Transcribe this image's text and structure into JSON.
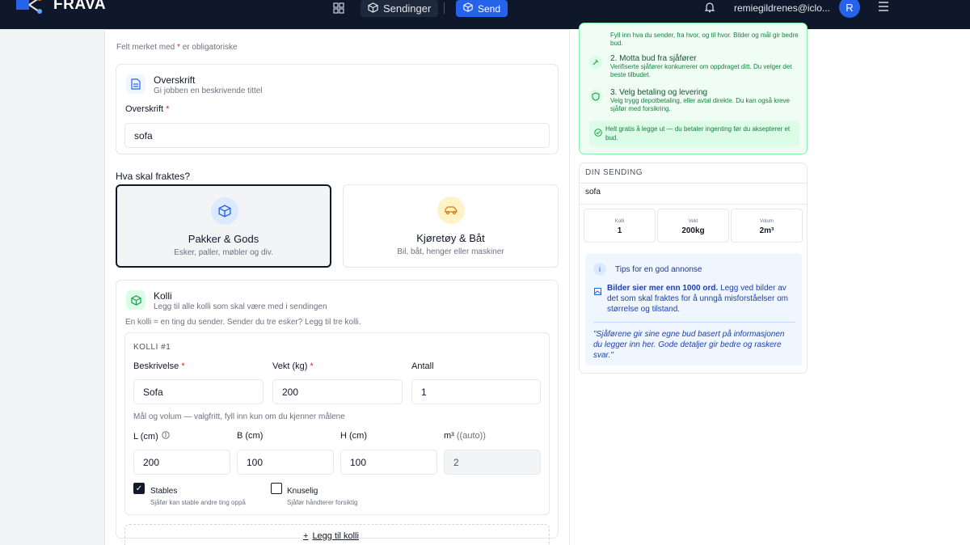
{
  "topbar": {
    "brand": "FRAVA",
    "nav_list_label": "Sendinger",
    "nav_send_label": "Send",
    "user_email": "remiegildrenes@iclo...",
    "avatar_initial": "R"
  },
  "form": {
    "required_note": "Felt merket med",
    "required_note_tail": "er obligatoriske",
    "heading_section": {
      "title": "Overskrift",
      "subtitle": "Gi jobben en beskrivende tittel",
      "field_label": "Overskrift",
      "value": "sofa"
    },
    "cargo_question": "Hva skal fraktes?",
    "cargo_options": [
      {
        "title": "Pakker & Gods",
        "subtitle": "Esker, paller, møbler og div.",
        "selected": true
      },
      {
        "title": "Kjøretøy & Båt",
        "subtitle": "Bil, båt, henger eller maskiner",
        "selected": false
      }
    ],
    "kolli_section": {
      "title": "Kolli",
      "subtitle": "Legg til alle kolli som skal være med i sendingen",
      "hint": "En kolli = en ting du sender. Sender du tre esker? Legg til tre kolli.",
      "item_title": "KOLLI #1",
      "description_label": "Beskrivelse",
      "description_value": "Sofa",
      "weight_label": "Vekt (kg)",
      "weight_value": "200",
      "count_label": "Antall",
      "count_value": "1",
      "dims_note": "Mål og volum — valgfritt, fyll inn kun om du kjenner målene",
      "length_label": "L (cm)",
      "length_value": "200",
      "width_label": "B (cm)",
      "width_value": "100",
      "height_label": "H (cm)",
      "height_value": "100",
      "volume_label": "m³",
      "volume_hint": "((auto))",
      "volume_value": "2",
      "stackable_label": "Stables",
      "stackable_desc": "Sjåfør kan stable andre ting oppå",
      "stackable_checked": true,
      "fragile_label": "Knuselig",
      "fragile_desc": "Sjåfør håndterer forsiktig",
      "fragile_checked": false,
      "add_kolli_label": "Legg til kolli"
    }
  },
  "sidebar": {
    "steps": [
      {
        "title": "",
        "desc": "Fyll inn hva du sender, fra hvor, og til hvor. Bilder og mål gir bedre bud."
      },
      {
        "title": "2. Motta bud fra sjåfører",
        "desc": "Verifiserte sjåfører konkurrerer om oppdraget ditt. Du velger det beste tilbudet."
      },
      {
        "title": "3. Velg betaling og levering",
        "desc": "Velg trygg depotbetaling, eller avtal direkte. Du kan også kreve sjåfør med forsikring."
      }
    ],
    "free_note": "Helt gratis å legge ut — du betaler ingenting før du aksepterer et bud.",
    "summary_heading": "DIN SENDING",
    "summary_title": "sofa",
    "stats": [
      {
        "label": "Kolli",
        "value": "1"
      },
      {
        "label": "Vekt",
        "value": "200kg"
      },
      {
        "label": "Volum",
        "value": "2m³"
      }
    ],
    "tips_title": "Tips for en god annonse",
    "tip_bold": "Bilder sier mer enn 1000 ord.",
    "tip_text": "Legg ved bilder av det som skal fraktes for å unngå misforståelser om størrelse og tilstand.",
    "quote": "\"Sjåførene gir sine egne bud basert på informasjonen du legger inn her. Gode detaljer gir bedre og raskere svar.\"",
    "colors": {
      "accent": "#2563eb",
      "green": "#16a34a",
      "topbar": "#0f172a"
    }
  }
}
